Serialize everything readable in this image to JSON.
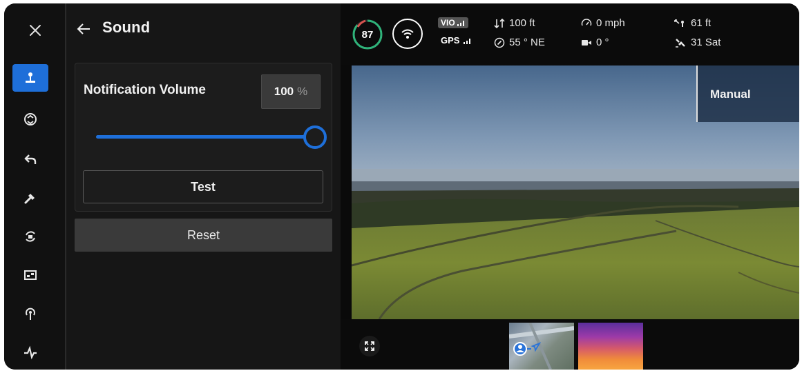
{
  "panel": {
    "title": "Sound",
    "volume_label": "Notification Volume",
    "volume_value": "100",
    "volume_unit": "%",
    "volume_level": 1.0,
    "test_label": "Test",
    "reset_label": "Reset"
  },
  "sidebar": {
    "items": [
      {
        "icon": "user-pilot-icon",
        "active": true
      },
      {
        "icon": "gimbal-icon",
        "active": false
      },
      {
        "icon": "return-home-icon",
        "active": false
      },
      {
        "icon": "tool-icon",
        "active": false
      },
      {
        "icon": "rotate-camera-icon",
        "active": false
      },
      {
        "icon": "aspect-ratio-icon",
        "active": false
      },
      {
        "icon": "signal-tower-icon",
        "active": false
      },
      {
        "icon": "activity-icon",
        "active": false
      }
    ]
  },
  "telemetry": {
    "battery": "87",
    "vio_label": "VIO",
    "gps_label": "GPS",
    "altitude": "100 ft",
    "heading": "55 ° NE",
    "speed": "0 mph",
    "gimbal_angle": "0 °",
    "distance": "61 ft",
    "satellites": "31 Sat"
  },
  "camera": {
    "mode_label": "Manual"
  },
  "colors": {
    "accent": "#1e6fd9",
    "battery_ring": "#2fb37a",
    "background": "#151515"
  }
}
